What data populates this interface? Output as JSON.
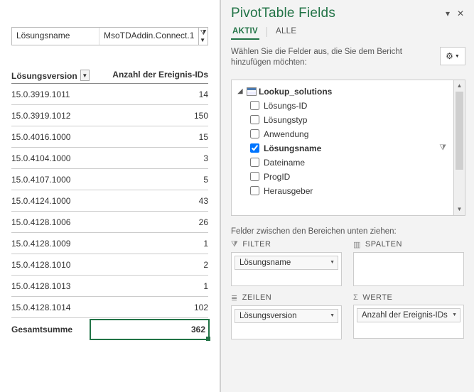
{
  "filter": {
    "label": "Lösungsname",
    "value": "MsoTDAddin.Connect.1"
  },
  "pivot": {
    "col1_header": "Lösungsversion",
    "col2_header": "Anzahl der Ereignis-IDs",
    "rows": [
      {
        "version": "15.0.3919.1011",
        "count": "14"
      },
      {
        "version": "15.0.3919.1012",
        "count": "150"
      },
      {
        "version": "15.0.4016.1000",
        "count": "15"
      },
      {
        "version": "15.0.4104.1000",
        "count": "3"
      },
      {
        "version": "15.0.4107.1000",
        "count": "5"
      },
      {
        "version": "15.0.4124.1000",
        "count": "43"
      },
      {
        "version": "15.0.4128.1006",
        "count": "26"
      },
      {
        "version": "15.0.4128.1009",
        "count": "1"
      },
      {
        "version": "15.0.4128.1010",
        "count": "2"
      },
      {
        "version": "15.0.4128.1013",
        "count": "1"
      },
      {
        "version": "15.0.4128.1014",
        "count": "102"
      }
    ],
    "total_label": "Gesamtsumme",
    "total_value": "362"
  },
  "pane": {
    "title": "PivotTable Fields",
    "tab_active": "AKTIV",
    "tab_all": "ALLE",
    "pick_text": "Wählen Sie die Felder aus, die Sie dem Bericht hinzufügen möchten:",
    "table_name": "Lookup_solutions",
    "fields": {
      "f0": "Lösungs-ID",
      "f1": "Lösungstyp",
      "f2": "Anwendung",
      "f3": "Lösungsname",
      "f4": "Dateiname",
      "f5": "ProgID",
      "f6": "Herausgeber"
    },
    "drag_label": "Felder zwischen den Bereichen unten ziehen:",
    "area_filter": "FILTER",
    "area_columns": "SPALTEN",
    "area_rows": "ZEILEN",
    "area_values": "WERTE",
    "item_filter": "Lösungsname",
    "item_rows": "Lösungsversion",
    "item_values": "Anzahl der Ereignis-IDs"
  },
  "icons": {
    "funnel": "⧩",
    "sigma": "Σ"
  }
}
